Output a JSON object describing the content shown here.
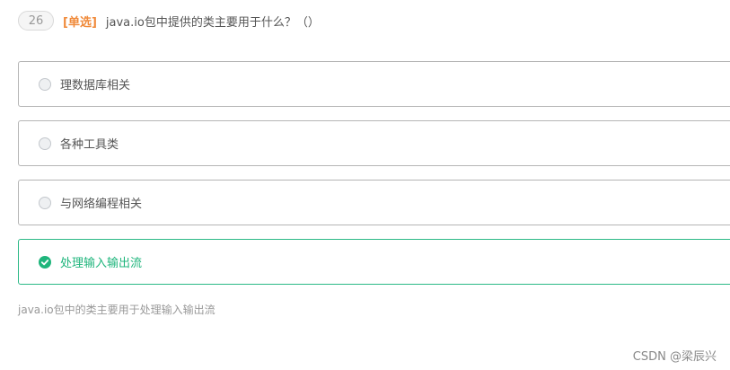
{
  "question": {
    "number": "26",
    "type_label": "[单选]",
    "text": "java.io包中提供的类主要用于什么？（）"
  },
  "options": [
    {
      "label": "理数据库相关",
      "selected": false
    },
    {
      "label": "各种工具类",
      "selected": false
    },
    {
      "label": "与网络编程相关",
      "selected": false
    },
    {
      "label": "处理输入输出流",
      "selected": true
    }
  ],
  "analysis": "java.io包中的类主要用于处理输入输出流",
  "watermark": "CSDN @梁辰兴",
  "colors": {
    "accent_green": "#1fb57c",
    "type_orange": "#f08a3a"
  }
}
